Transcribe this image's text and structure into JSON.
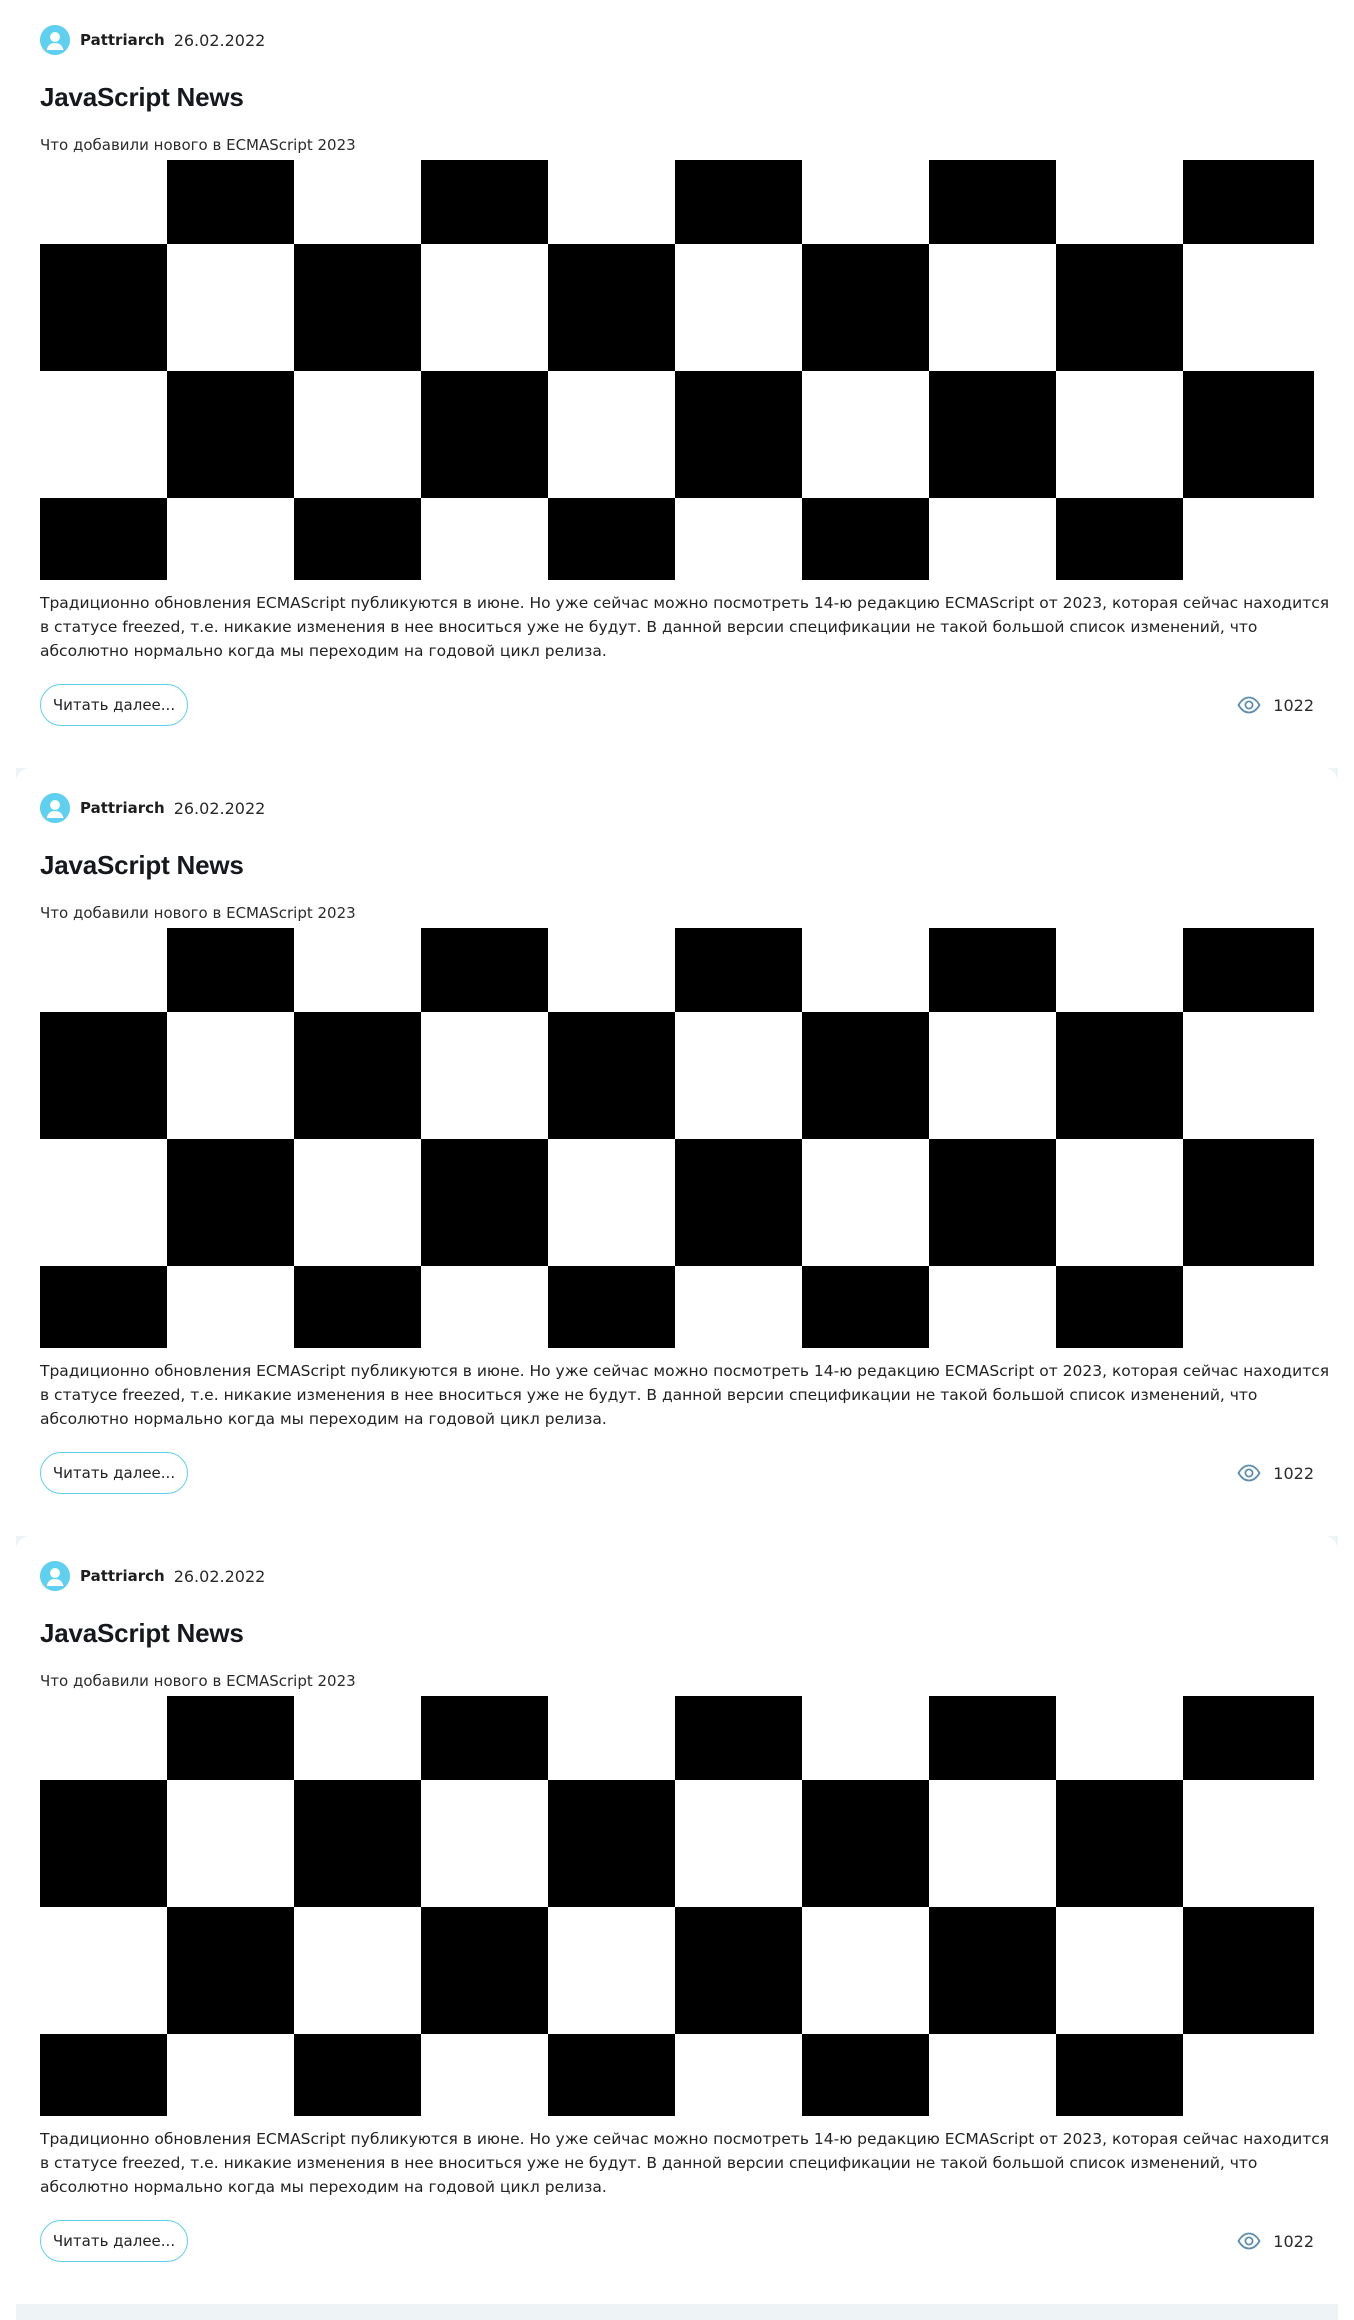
{
  "posts": [
    {
      "author": "Pattriarch",
      "date": "26.02.2022",
      "title": "JavaScript News",
      "subtitle": "Что добавили нового в ECMAScript 2023",
      "excerpt": "Традиционно обновления ECMAScript публикуются в июне. Но уже сейчас можно посмотреть 14-ю редакцию ECMAScript от 2023, которая сейчас находится в статусе freezed, т.е. никакие изменения в нее вноситься уже не будут. В данной версии спецификации не такой большой список изменений, что абсолютно нормально когда мы переходим на годовой цикл релиза.",
      "read_more_label": "Читать далее...",
      "views": "1022"
    },
    {
      "author": "Pattriarch",
      "date": "26.02.2022",
      "title": "JavaScript News",
      "subtitle": "Что добавили нового в ECMAScript 2023",
      "excerpt": "Традиционно обновления ECMAScript публикуются в июне. Но уже сейчас можно посмотреть 14-ю редакцию ECMAScript от 2023, которая сейчас находится в статусе freezed, т.е. никакие изменения в нее вноситься уже не будут. В данной версии спецификации не такой большой список изменений, что абсолютно нормально когда мы переходим на годовой цикл релиза.",
      "read_more_label": "Читать далее...",
      "views": "1022"
    },
    {
      "author": "Pattriarch",
      "date": "26.02.2022",
      "title": "JavaScript News",
      "subtitle": "Что добавили нового в ECMAScript 2023",
      "excerpt": "Традиционно обновления ECMAScript публикуются в июне. Но уже сейчас можно посмотреть 14-ю редакцию ECMAScript от 2023, которая сейчас находится в статусе freezed, т.е. никакие изменения в нее вноситься уже не будут. В данной версии спецификации не такой большой список изменений, что абсолютно нормально когда мы переходим на годовой цикл релиза.",
      "read_more_label": "Читать далее...",
      "views": "1022"
    }
  ],
  "icons": {
    "avatar": "user-avatar-icon",
    "views": "eye-icon",
    "image": "checkerboard-image"
  },
  "colors": {
    "accent": "#5fd0ef",
    "separator": "#eef3f5",
    "eye_icon": "#5e8fb3",
    "title": "#15191d"
  }
}
